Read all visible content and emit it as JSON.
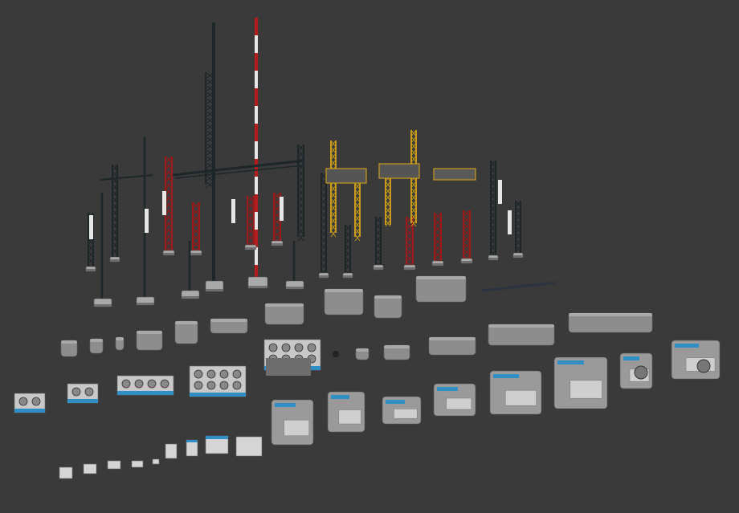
{
  "scene": {
    "description_visible_text": "",
    "palette": {
      "background": "#3a3a3a",
      "steel_dark": "#1d2628",
      "lattice_red": "#9b1b1b",
      "lattice_yellow": "#c79a1c",
      "concrete": "#8d8d8d",
      "concrete_light": "#a9a9a9",
      "stripe_white": "#e6e6e6",
      "stripe_red": "#b31d1d",
      "cooling_blue": "#2f8fc4",
      "metal_light": "#c8c8c8"
    }
  }
}
